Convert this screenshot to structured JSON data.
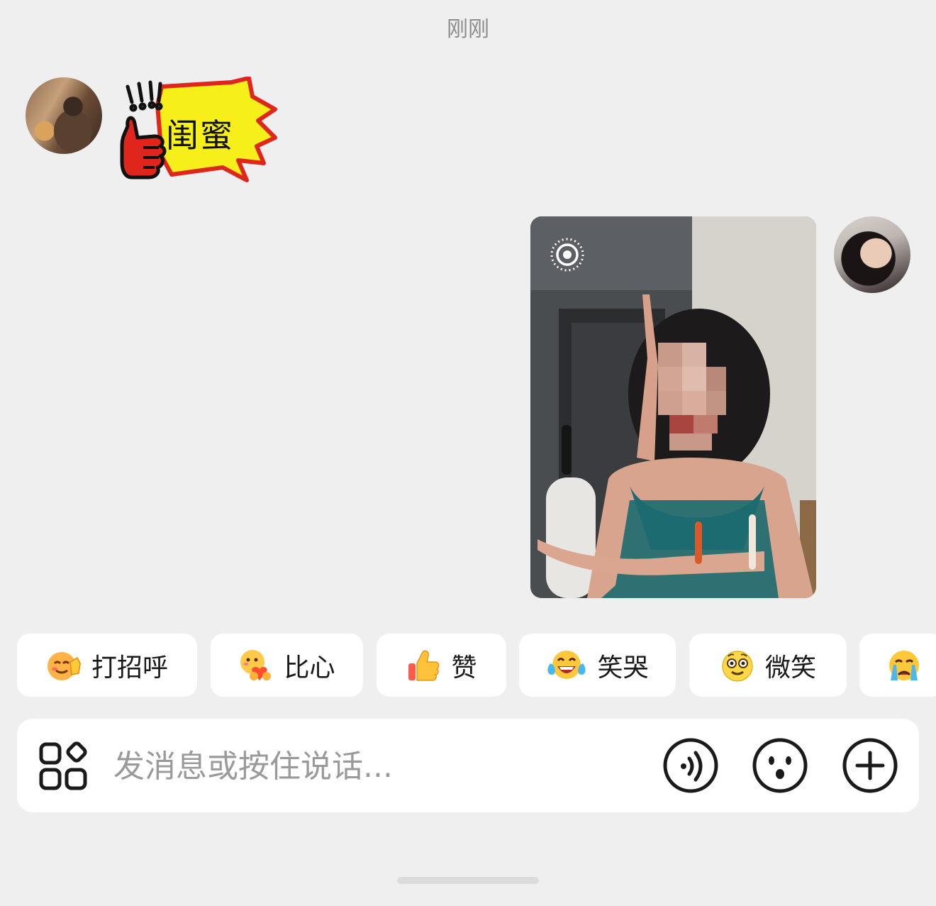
{
  "header": {
    "timestamp": "刚刚"
  },
  "messages": {
    "incoming_sticker": {
      "text": "闺蜜",
      "marks": "!!!",
      "icon": "thumbs-up-sticker"
    },
    "outgoing_image": {
      "badge_icon": "live-photo-icon"
    }
  },
  "quick_replies": [
    {
      "label": "打招呼",
      "icon": "wave-emoji"
    },
    {
      "label": "比心",
      "icon": "heart-hands-emoji"
    },
    {
      "label": "赞",
      "icon": "thumbs-up-emoji"
    },
    {
      "label": "笑哭",
      "icon": "laugh-cry-emoji"
    },
    {
      "label": "微笑",
      "icon": "smile-emoji"
    },
    {
      "label": "",
      "icon": "crying-emoji"
    }
  ],
  "composer": {
    "placeholder": "发消息或按住说话...",
    "icons": [
      "apps-icon",
      "voice-icon",
      "emoji-icon",
      "plus-icon"
    ]
  },
  "colors": {
    "background": "#efefef",
    "sticker_yellow": "#f7ef1a",
    "sticker_red": "#e0261c"
  }
}
